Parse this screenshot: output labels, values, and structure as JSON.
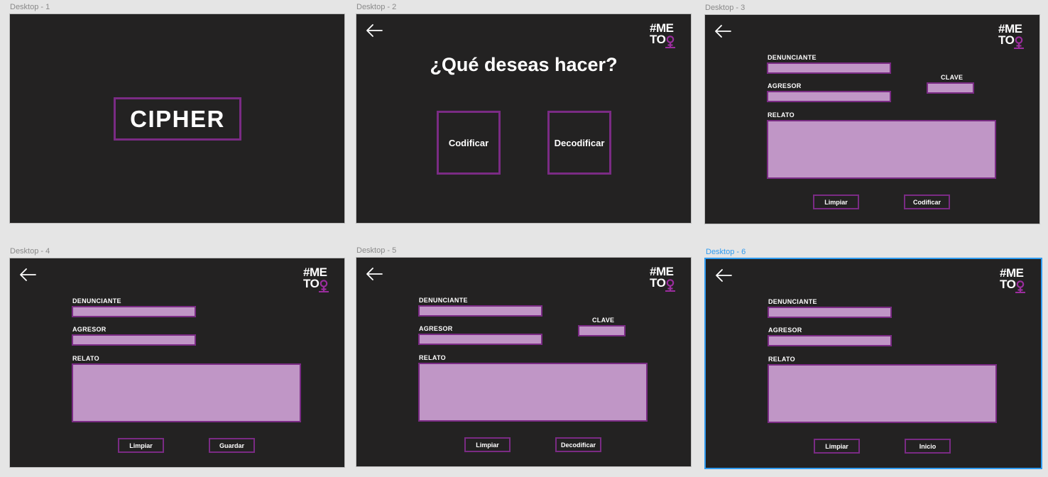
{
  "frames": {
    "d1": {
      "label": "Desktop - 1",
      "title": "CIPHER"
    },
    "d2": {
      "label": "Desktop - 2",
      "question": "¿Qué deseas hacer?",
      "encode": "Codificar",
      "decode": "Decodificar"
    },
    "d3": {
      "label": "Desktop - 3",
      "denunciante": "DENUNCIANTE",
      "agresor": "AGRESOR",
      "clave": "CLAVE",
      "relato": "RELATO",
      "btn1": "Limpiar",
      "btn2": "Codificar"
    },
    "d4": {
      "label": "Desktop - 4",
      "denunciante": "DENUNCIANTE",
      "agresor": "AGRESOR",
      "relato": "RELATO",
      "btn1": "Limpiar",
      "btn2": "Guardar"
    },
    "d5": {
      "label": "Desktop - 5",
      "denunciante": "DENUNCIANTE",
      "agresor": "AGRESOR",
      "clave": "CLAVE",
      "relato": "RELATO",
      "btn1": "Limpiar",
      "btn2": "Decodificar"
    },
    "d6": {
      "label": "Desktop - 6",
      "denunciante": "DENUNCIANTE",
      "agresor": "AGRESOR",
      "relato": "RELATO",
      "btn1": "Limpiar",
      "btn2": "Inicio"
    }
  },
  "logo": {
    "line1": "#ME",
    "line2": "TO"
  },
  "icons": {
    "back": "arrow-left-icon",
    "logo_symbol": "venus-symbol-icon"
  },
  "colors": {
    "frame_bg": "#232222",
    "accent": "#7a2b84",
    "field_fill": "#c096c6",
    "selection": "#2f9bf0",
    "canvas": "#e5e5e5"
  }
}
